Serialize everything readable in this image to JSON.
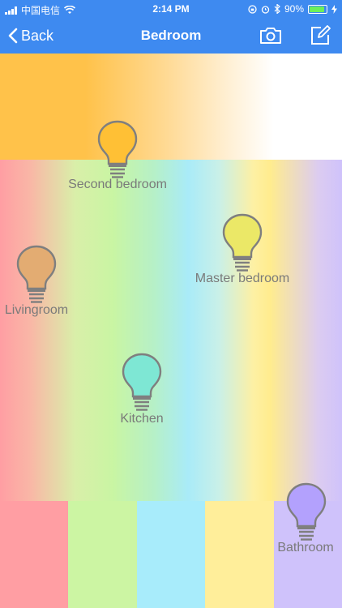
{
  "status_bar": {
    "carrier": "中国电信",
    "time": "2:14 PM",
    "battery_text": "90%",
    "battery_level": 0.9,
    "battery_color": "#6cf05a"
  },
  "nav": {
    "back_label": "Back",
    "title": "Bedroom",
    "background": "#3e8af0"
  },
  "icons": {
    "camera": "camera-icon",
    "edit": "edit-icon",
    "back": "chevron-left-icon"
  },
  "swatches": [
    "#ff9ea3",
    "#ccf5a3",
    "#a8ecfb",
    "#ffee9a",
    "#cfc2fb"
  ],
  "rooms": [
    {
      "name": "Second bedroom",
      "color": "#ffc035"
    },
    {
      "name": "Master bedroom",
      "color": "#ebe867"
    },
    {
      "name": "Livingroom",
      "color": "#e3ac72"
    },
    {
      "name": "Kitchen",
      "color": "#7ee7d4"
    },
    {
      "name": "Bathroom",
      "color": "#b3a1fd"
    }
  ]
}
